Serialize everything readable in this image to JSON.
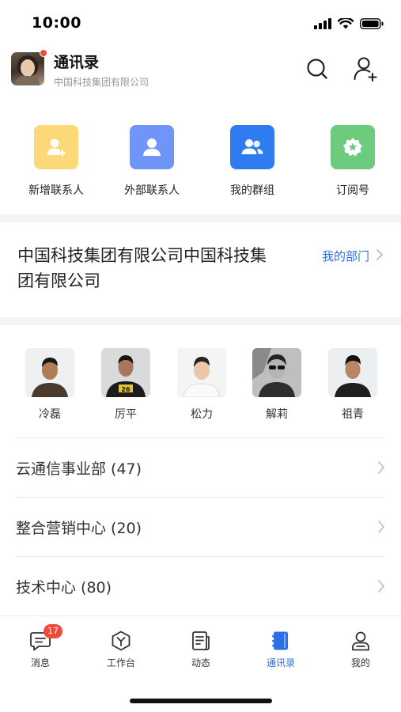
{
  "status_bar": {
    "time": "10:00"
  },
  "header": {
    "title": "通讯录",
    "subtitle": "中国科技集团有限公司"
  },
  "quick_actions": [
    {
      "label": "新增联系人",
      "icon": "add-contact-icon",
      "color": "#fcd978"
    },
    {
      "label": "外部联系人",
      "icon": "person-icon",
      "color": "#6e95f7"
    },
    {
      "label": "我的群组",
      "icon": "group-icon",
      "color": "#2f7cf1"
    },
    {
      "label": "订阅号",
      "icon": "star-badge-icon",
      "color": "#6ccb7c"
    }
  ],
  "organization": {
    "name": "中国科技集团有限公司中国科技集团有限公司",
    "link_label": "我的部门"
  },
  "people": [
    {
      "name": "冷磊"
    },
    {
      "name": "厉平"
    },
    {
      "name": "松力"
    },
    {
      "name": "解莉"
    },
    {
      "name": "祖青"
    }
  ],
  "departments": [
    {
      "label": "云通信事业部 (47)"
    },
    {
      "label": "整合营销中心 (20)"
    },
    {
      "label": "技术中心 (80)"
    }
  ],
  "tabbar": {
    "items": [
      {
        "label": "消息",
        "icon": "message-icon",
        "badge": "17"
      },
      {
        "label": "工作台",
        "icon": "workbench-icon"
      },
      {
        "label": "动态",
        "icon": "feed-icon"
      },
      {
        "label": "通讯录",
        "icon": "contacts-book-icon",
        "active": true
      },
      {
        "label": "我的",
        "icon": "profile-icon"
      }
    ]
  },
  "colors": {
    "accent": "#2c6fe6",
    "badge": "#f04a3b"
  }
}
